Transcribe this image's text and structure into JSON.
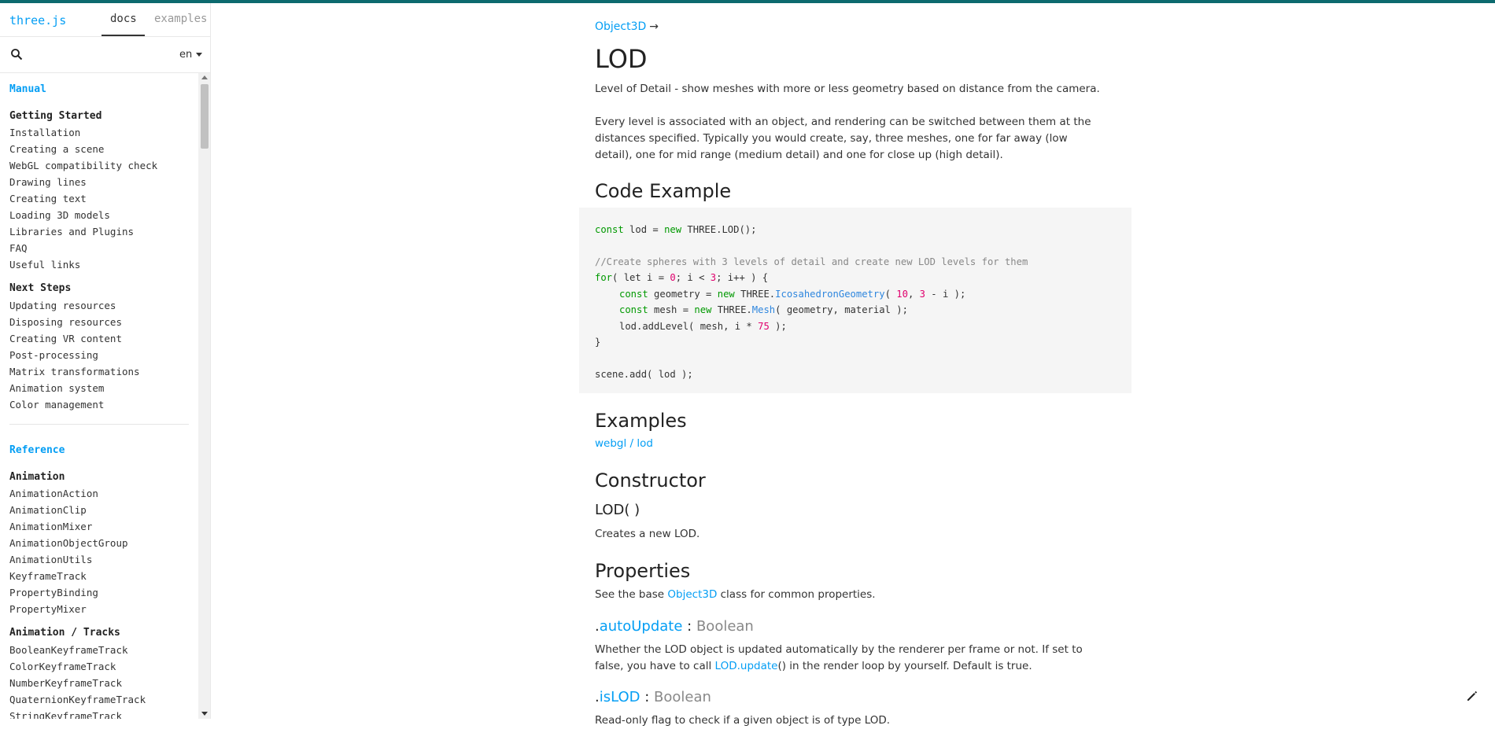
{
  "sidebar": {
    "logo": "three.js",
    "tabs": {
      "docs": "docs",
      "examples": "examples"
    },
    "search_placeholder": "",
    "language": "en",
    "sections": [
      {
        "title": "Manual"
      },
      {
        "title": "Reference"
      }
    ],
    "groups": {
      "getting_started": {
        "title": "Getting Started",
        "items": [
          "Installation",
          "Creating a scene",
          "WebGL compatibility check",
          "Drawing lines",
          "Creating text",
          "Loading 3D models",
          "Libraries and Plugins",
          "FAQ",
          "Useful links"
        ]
      },
      "next_steps": {
        "title": "Next Steps",
        "items": [
          "Updating resources",
          "Disposing resources",
          "Creating VR content",
          "Post-processing",
          "Matrix transformations",
          "Animation system",
          "Color management"
        ]
      },
      "animation": {
        "title": "Animation",
        "items": [
          "AnimationAction",
          "AnimationClip",
          "AnimationMixer",
          "AnimationObjectGroup",
          "AnimationUtils",
          "KeyframeTrack",
          "PropertyBinding",
          "PropertyMixer"
        ]
      },
      "animation_tracks": {
        "title": "Animation / Tracks",
        "items": [
          "BooleanKeyframeTrack",
          "ColorKeyframeTrack",
          "NumberKeyframeTrack",
          "QuaternionKeyframeTrack",
          "StringKeyframeTrack"
        ]
      }
    }
  },
  "content": {
    "breadcrumb": "Object3D",
    "breadcrumb_arrow": "→",
    "title": "LOD",
    "intro": "Level of Detail - show meshes with more or less geometry based on distance from the camera.",
    "description": "Every level is associated with an object, and rendering can be switched between them at the distances specified. Typically you would create, say, three meshes, one for far away (low detail), one for mid range (medium detail) and one for close up (high detail).",
    "code_example_heading": "Code Example",
    "code": {
      "l1_kw1": "const",
      "l1_a": " lod = ",
      "l1_kw2": "new",
      "l1_b": " THREE.LOD();",
      "l2_comment": "//Create spheres with 3 levels of detail and create new LOD levels for them",
      "l3_kw": "for",
      "l3_a": "( let i = ",
      "l3_n1": "0",
      "l3_b": "; i < ",
      "l3_n2": "3",
      "l3_c": "; i++ ) {",
      "l4_kw1": "const",
      "l4_a": " geometry = ",
      "l4_kw2": "new",
      "l4_b": " THREE.",
      "l4_fn": "IcosahedronGeometry",
      "l4_c": "( ",
      "l4_n1": "10",
      "l4_d": ", ",
      "l4_n2": "3",
      "l4_e": " - i );",
      "l5_kw1": "const",
      "l5_a": " mesh = ",
      "l5_kw2": "new",
      "l5_b": " THREE.",
      "l5_fn": "Mesh",
      "l5_c": "( geometry, material );",
      "l6_a": "lod.addLevel( mesh, i * ",
      "l6_n": "75",
      "l6_b": " );",
      "l7": "}",
      "l8": "scene.add( lod );"
    },
    "examples_heading": "Examples",
    "examples_link": "webgl / lod",
    "constructor_heading": "Constructor",
    "constructor_signature": "LOD( )",
    "constructor_desc": "Creates a new LOD.",
    "properties_heading": "Properties",
    "properties_intro_a": "See the base ",
    "properties_intro_link": "Object3D",
    "properties_intro_b": " class for common properties.",
    "prop1": {
      "dot": ".",
      "name": "autoUpdate",
      "sep": " : ",
      "type": "Boolean"
    },
    "prop1_desc_a": "Whether the LOD object is updated automatically by the renderer per frame or not. If set to false, you have to call ",
    "prop1_desc_link": "LOD.update",
    "prop1_desc_b": "() in the render loop by yourself. Default is true.",
    "prop2": {
      "dot": ".",
      "name": "isLOD",
      "sep": " : ",
      "type": "Boolean"
    },
    "prop2_desc": "Read-only flag to check if a given object is of type LOD."
  },
  "colors": {
    "accent": "#049ef4",
    "topbar": "#0c6a6e"
  }
}
